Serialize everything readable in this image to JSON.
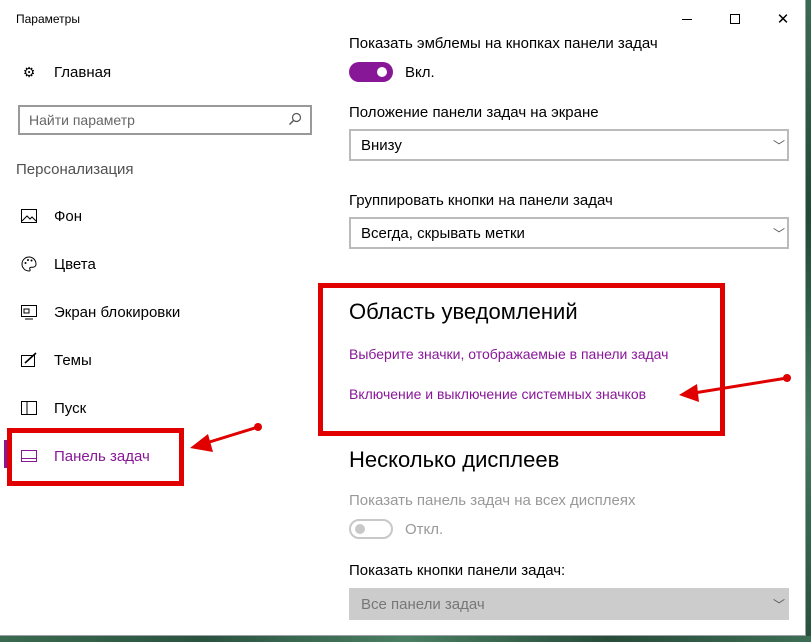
{
  "window": {
    "title": "Параметры"
  },
  "sidebar": {
    "home": "Главная",
    "search_placeholder": "Найти параметр",
    "section": "Персонализация",
    "items": [
      {
        "label": "Фон",
        "icon": "image-icon"
      },
      {
        "label": "Цвета",
        "icon": "palette-icon"
      },
      {
        "label": "Экран блокировки",
        "icon": "lock-screen-icon"
      },
      {
        "label": "Темы",
        "icon": "themes-brush-icon"
      },
      {
        "label": "Пуск",
        "icon": "start-grid-icon"
      },
      {
        "label": "Панель задач",
        "icon": "taskbar-icon",
        "selected": true
      }
    ]
  },
  "main": {
    "badges_label": "Показать эмблемы на кнопках панели задач",
    "badges_toggle": {
      "state": "Вкл.",
      "on": true
    },
    "position_label": "Положение панели задач на экране",
    "position_value": "Внизу",
    "grouping_label": "Группировать кнопки на панели задач",
    "grouping_value": "Всегда, скрывать метки",
    "notification_heading": "Область уведомлений",
    "notification_links": [
      "Выберите значки, отображаемые в панели задач",
      "Включение и выключение системных значков"
    ],
    "multi_heading": "Несколько дисплеев",
    "multi_show_label": "Показать панель задач на всех дисплеях",
    "multi_toggle": {
      "state": "Откл.",
      "on": false
    },
    "multi_buttons_label": "Показать кнопки панели задач:",
    "multi_buttons_value": "Все панели задач"
  },
  "colors": {
    "accent": "#881798",
    "annotation": "#e00000"
  }
}
